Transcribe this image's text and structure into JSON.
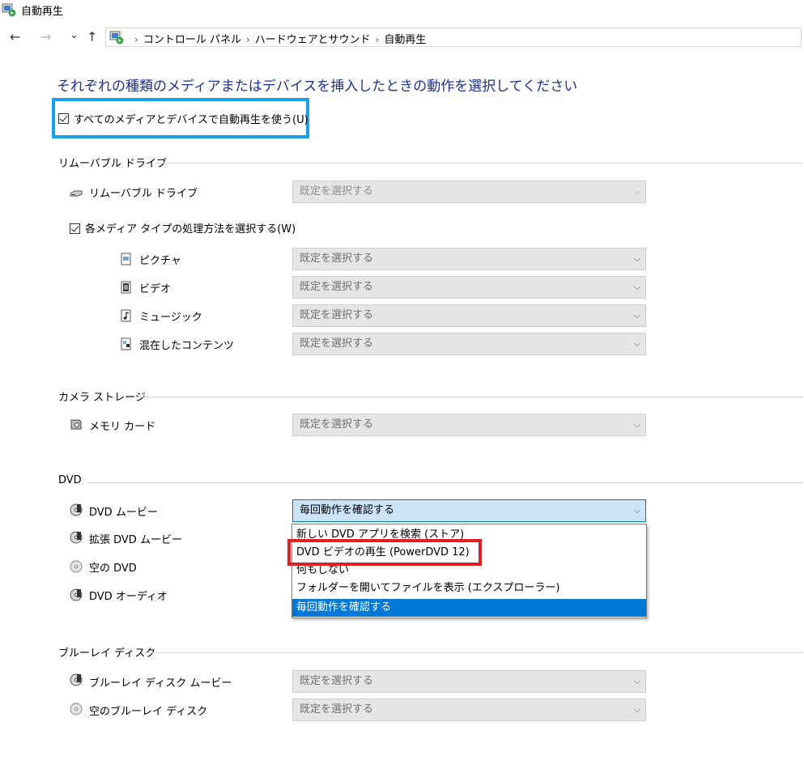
{
  "window": {
    "title": "自動再生"
  },
  "nav": {
    "back": "←",
    "forward": "→",
    "recent": "⌄",
    "up": "↑",
    "breadcrumb": [
      "コントロール パネル",
      "ハードウェアとサウンド",
      "自動再生"
    ],
    "sep": "›"
  },
  "heading": "それぞれの種類のメディアまたはデバイスを挿入したときの動作を選択してください",
  "use_autoplay": {
    "label": "すべてのメディアとデバイスで自動再生を使う(U)",
    "checked": true
  },
  "removable": {
    "section": "リムーバブル ドライブ",
    "drive": {
      "label": "リムーバブル ドライブ",
      "value": "既定を選択する"
    },
    "per_media": {
      "label": "各メディア タイプの処理方法を選択する(W)",
      "checked": true
    },
    "items": [
      {
        "label": "ピクチャ",
        "value": "既定を選択する"
      },
      {
        "label": "ビデオ",
        "value": "既定を選択する"
      },
      {
        "label": "ミュージック",
        "value": "既定を選択する"
      },
      {
        "label": "混在したコンテンツ",
        "value": "既定を選択する"
      }
    ]
  },
  "camera": {
    "section": "カメラ ストレージ",
    "items": [
      {
        "label": "メモリ カード",
        "value": "既定を選択する"
      }
    ]
  },
  "dvd": {
    "section": "DVD",
    "items": [
      {
        "label": "DVD ムービー",
        "value": "毎回動作を確認する"
      },
      {
        "label": "拡張 DVD ムービー"
      },
      {
        "label": "空の DVD"
      },
      {
        "label": "DVD オーディオ"
      }
    ],
    "dropdown_options": [
      "新しい DVD アプリを検索 (ストア)",
      "DVD ビデオの再生 (PowerDVD 12)",
      "何もしない",
      "フォルダーを開いてファイルを表示 (エクスプローラー)",
      "毎回動作を確認する"
    ],
    "selected_option": "毎回動作を確認する"
  },
  "bluray": {
    "section": "ブルーレイ ディスク",
    "items": [
      {
        "label": "ブルーレイ ディスク ムービー",
        "value": "既定を選択する"
      },
      {
        "label": "空のブルーレイ ディスク",
        "value": "既定を選択する"
      }
    ]
  },
  "chevron": "⌵",
  "colors": {
    "heading": "#1e3287",
    "highlight_blue": "#1aa0e8",
    "highlight_red": "#e21d23",
    "selection": "#0078d7"
  }
}
